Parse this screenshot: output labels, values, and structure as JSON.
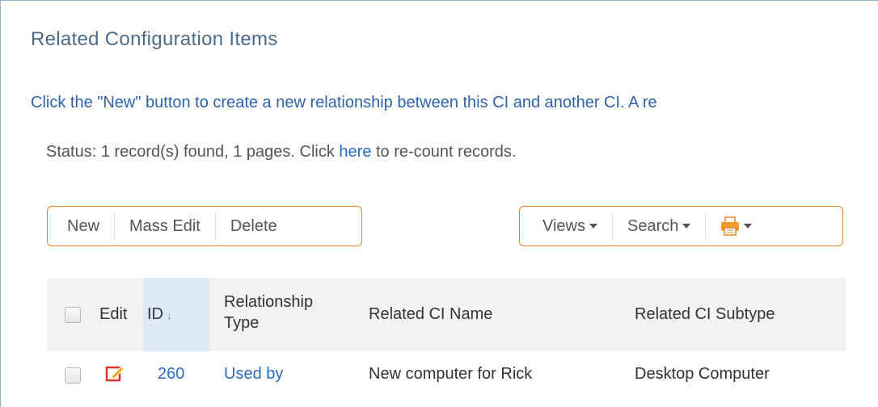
{
  "section": {
    "title": "Related Configuration Items",
    "help_text": "Click the \"New\" button to create a new relationship between this CI and another CI. A re",
    "status_prefix": "Status: 1 record(s) found, 1 pages. Click ",
    "status_link": "here",
    "status_suffix": " to re-count records."
  },
  "toolbar_left": {
    "new_label": "New",
    "mass_edit_label": "Mass Edit",
    "delete_label": "Delete"
  },
  "toolbar_right": {
    "views_label": "Views",
    "search_label": "Search",
    "print_icon": "printer-icon"
  },
  "grid": {
    "columns": {
      "edit": "Edit",
      "id": "ID",
      "id_sort_icon": "sort-down-icon",
      "relationship_type_line1": "Relationship",
      "relationship_type_line2": "Type",
      "related_ci_name": "Related CI Name",
      "related_ci_subtype": "Related CI Subtype"
    },
    "rows": [
      {
        "edit_icon": "edit-icon",
        "id": "260",
        "relationship_type": "Used by",
        "related_ci_name": "New computer for Rick",
        "related_ci_subtype": "Desktop Computer"
      }
    ]
  },
  "colors": {
    "accent_orange": "#e8862e",
    "link_blue": "#2a6bc5",
    "title_blue": "#506a86"
  }
}
